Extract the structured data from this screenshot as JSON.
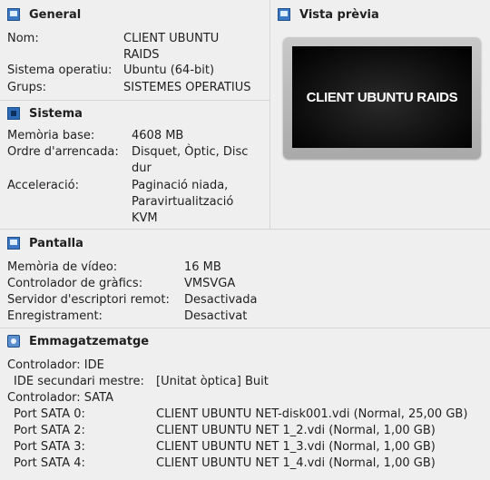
{
  "general": {
    "title": "General",
    "rows": [
      {
        "label": "Nom:",
        "value": "CLIENT UBUNTU RAIDS"
      },
      {
        "label": "Sistema operatiu:",
        "value": "Ubuntu (64-bit)"
      },
      {
        "label": "Grups:",
        "value": "SISTEMES OPERATIUS"
      }
    ]
  },
  "preview": {
    "title": "Vista prèvia",
    "screen_text": "CLIENT UBUNTU RAIDS"
  },
  "system": {
    "title": "Sistema",
    "rows": [
      {
        "label": "Memòria base:",
        "value": "4608 MB"
      },
      {
        "label": "Ordre d'arrencada:",
        "value": "Disquet, Òptic, Disc dur"
      },
      {
        "label": "Acceleració:",
        "value": "Paginació niada, Paravirtualització KVM"
      }
    ]
  },
  "display": {
    "title": "Pantalla",
    "rows": [
      {
        "label": "Memòria de vídeo:",
        "value": "16 MB"
      },
      {
        "label": "Controlador de gràfics:",
        "value": "VMSVGA"
      },
      {
        "label": "Servidor d'escriptori remot:",
        "value": "Desactivada"
      },
      {
        "label": "Enregistrament:",
        "value": "Desactivat"
      }
    ]
  },
  "storage": {
    "title": "Emmagatzematge",
    "controller_ide": "Controlador: IDE",
    "ide_rows": [
      {
        "label": "IDE secundari mestre:",
        "value": "[Unitat òptica] Buit"
      }
    ],
    "controller_sata": "Controlador: SATA",
    "sata_rows": [
      {
        "label": "Port SATA 0:",
        "value": "CLIENT UBUNTU NET-disk001.vdi (Normal, 25,00 GB)"
      },
      {
        "label": "Port SATA 2:",
        "value": "CLIENT UBUNTU NET 1_2.vdi (Normal, 1,00 GB)"
      },
      {
        "label": "Port SATA 3:",
        "value": "CLIENT UBUNTU NET 1_3.vdi (Normal, 1,00 GB)"
      },
      {
        "label": "Port SATA 4:",
        "value": "CLIENT UBUNTU NET 1_4.vdi (Normal, 1,00 GB)"
      }
    ]
  }
}
